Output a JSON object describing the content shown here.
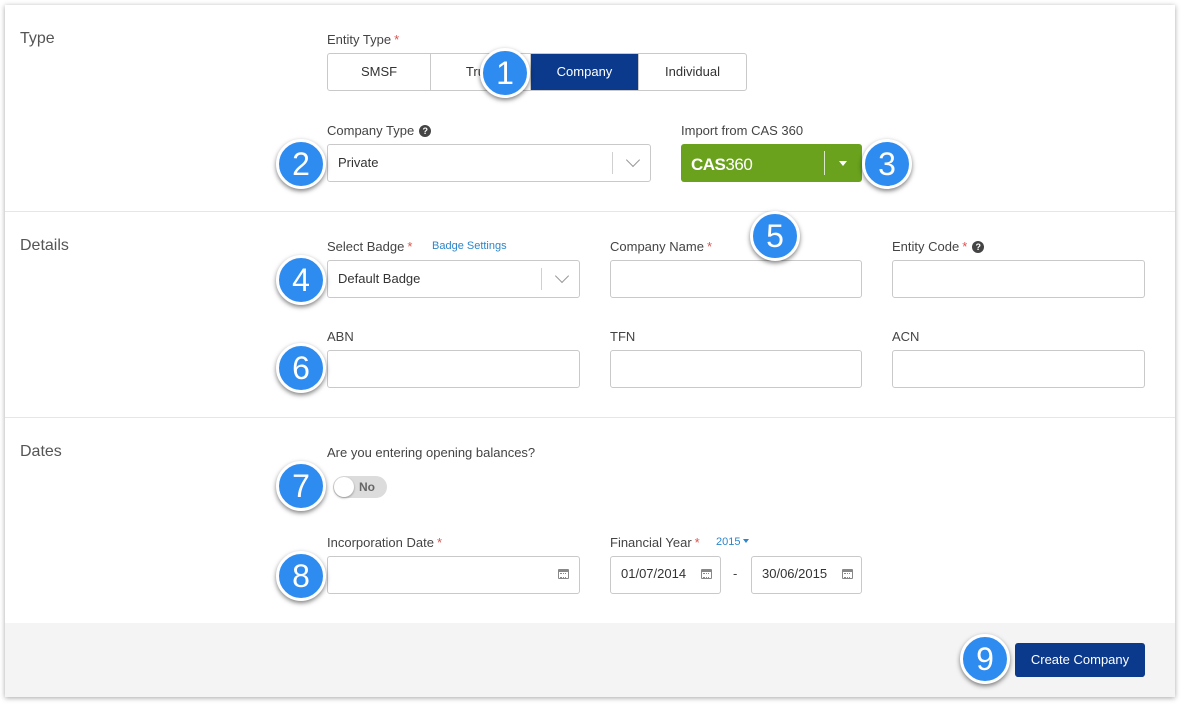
{
  "type_section": {
    "title": "Type",
    "entity_type_label": "Entity Type",
    "required_mark": "*",
    "entity_types": [
      "SMSF",
      "Trust",
      "Company",
      "Individual"
    ],
    "selected_entity_type": "Company",
    "company_type_label": "Company Type",
    "company_type_value": "Private",
    "import_label": "Import from CAS 360",
    "cas_logo_bold": "CAS",
    "cas_logo_light": "360"
  },
  "details_section": {
    "title": "Details",
    "select_badge_label": "Select Badge",
    "badge_settings_link": "Badge Settings",
    "badge_value": "Default Badge",
    "company_name_label": "Company Name",
    "company_name_value": "",
    "entity_code_label": "Entity Code",
    "entity_code_value": "",
    "abn_label": "ABN",
    "tfn_label": "TFN",
    "acn_label": "ACN"
  },
  "dates_section": {
    "title": "Dates",
    "opening_balances_question": "Are you entering opening balances?",
    "opening_balances_toggle": "No",
    "incorporation_date_label": "Incorporation Date",
    "incorporation_date_value": "",
    "financial_year_label": "Financial Year",
    "financial_year_selected": "2015",
    "fy_start": "01/07/2014",
    "fy_separator": "-",
    "fy_end": "30/06/2015"
  },
  "footer": {
    "create_button": "Create Company"
  },
  "callouts": [
    "1",
    "2",
    "3",
    "4",
    "5",
    "6",
    "7",
    "8",
    "9"
  ],
  "colors": {
    "primary": "#0b3a8c",
    "cas_green": "#6aa21d",
    "callout_blue": "#2e8bf0",
    "required_red": "#d9534f",
    "link_blue": "#2e86c9"
  },
  "icons": [
    "help-icon",
    "chevron-down-icon",
    "caret-down-icon",
    "calendar-icon",
    "cas360-logo"
  ]
}
